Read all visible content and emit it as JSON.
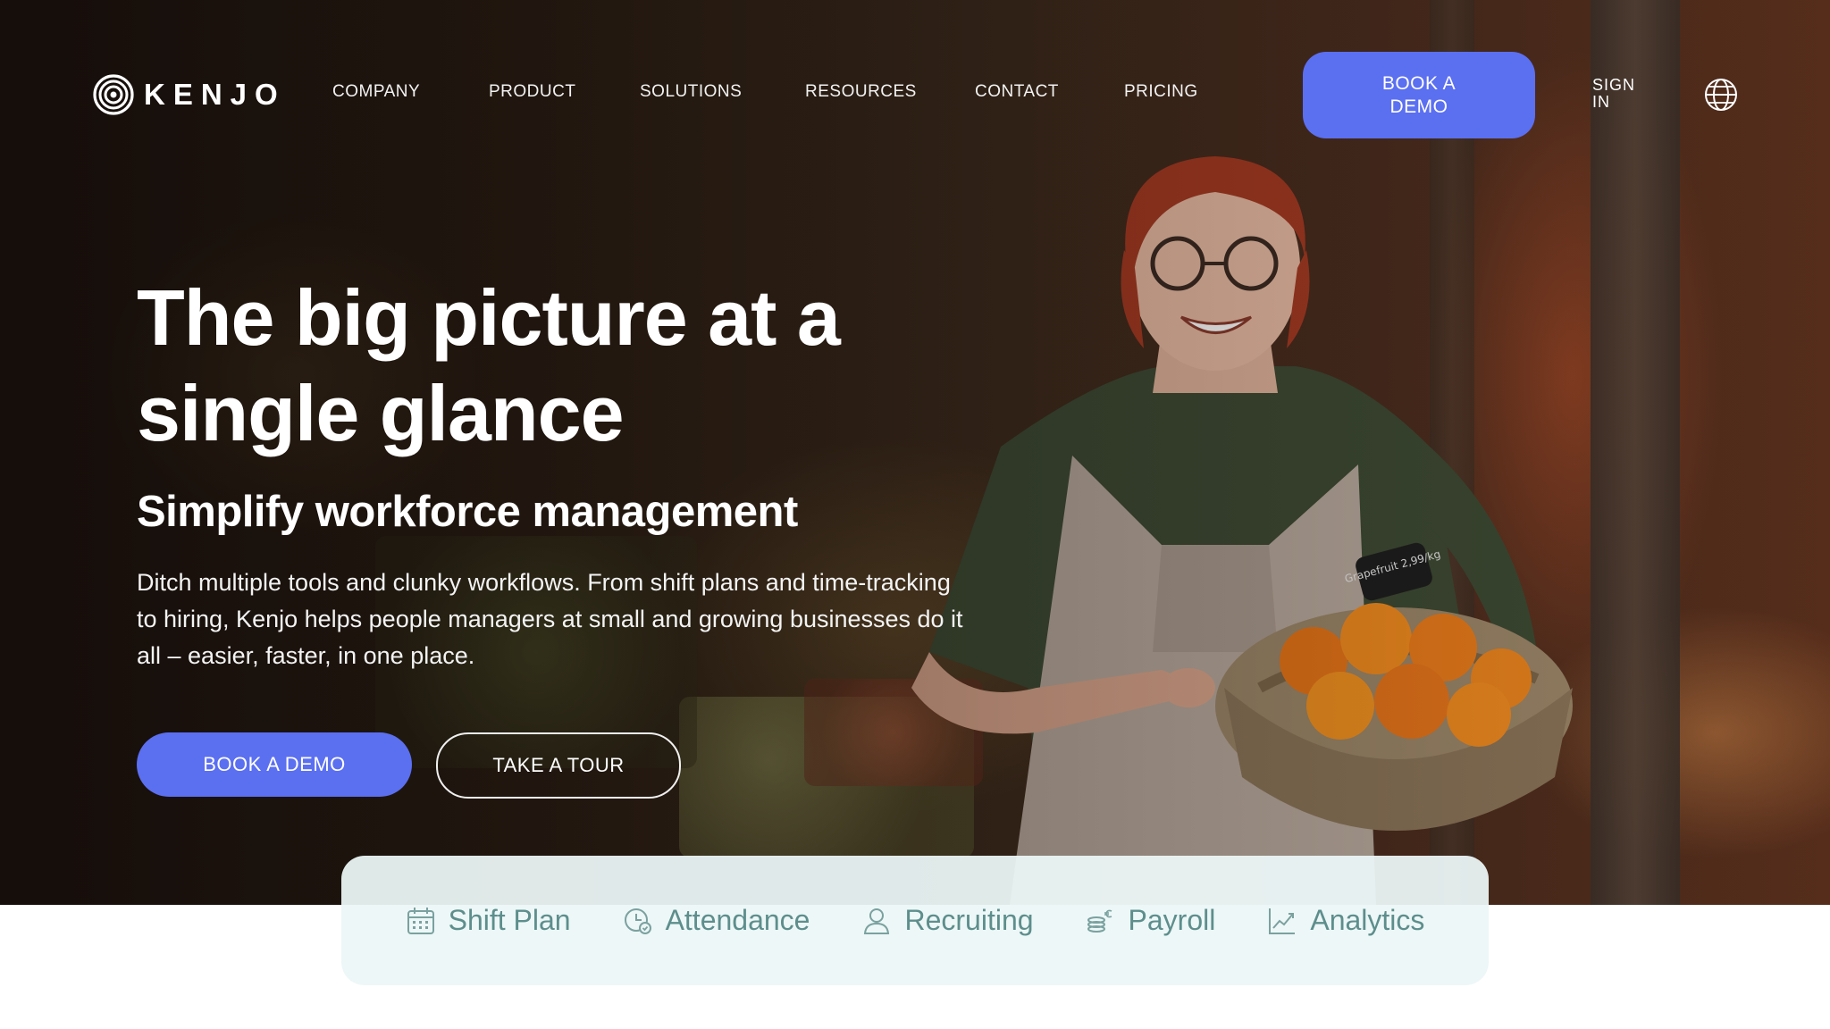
{
  "brand": {
    "name": "KENJO",
    "logo_icon": "kenjo-spiral-icon"
  },
  "nav": {
    "items": [
      "COMPANY",
      "PRODUCT",
      "SOLUTIONS",
      "RESOURCES",
      "CONTACT",
      "PRICING"
    ],
    "book_demo_label": "BOOK A DEMO",
    "sign_in_label": "SIGN IN",
    "language_icon": "globe-icon"
  },
  "hero": {
    "title": "The big picture at a single glance",
    "subtitle": "Simplify workforce management",
    "description": "Ditch multiple tools and clunky workflows. From shift plans and time-tracking to hiring, Kenjo helps people managers at small and growing businesses do it all – easier, faster, in one place.",
    "primary_cta": "BOOK A DEMO",
    "secondary_cta": "TAKE A TOUR",
    "basket_tag": "Grapefruit 2,99/kg"
  },
  "features": [
    {
      "label": "Shift Plan",
      "icon": "calendar-icon"
    },
    {
      "label": "Attendance",
      "icon": "clock-icon"
    },
    {
      "label": "Recruiting",
      "icon": "person-icon"
    },
    {
      "label": "Payroll",
      "icon": "coins-euro-icon"
    },
    {
      "label": "Analytics",
      "icon": "chart-line-icon"
    }
  ],
  "colors": {
    "accent": "#5b6ff1",
    "feature_text": "#5d8e8c",
    "feature_bar_bg": "#ecf6f6"
  }
}
